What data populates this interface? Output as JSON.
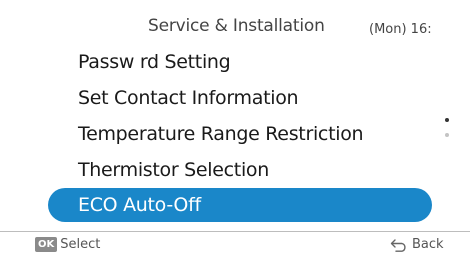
{
  "header": {
    "title": "Service & Installation",
    "clock": "(Mon) 16:"
  },
  "menu": {
    "items": [
      {
        "label": "Passw  rd Setting"
      },
      {
        "label": "Set Contact Information"
      },
      {
        "label": "Temperature Range Restriction"
      },
      {
        "label": "Thermistor Selection"
      },
      {
        "label": "ECO Auto-Off"
      }
    ],
    "selected_index": 4
  },
  "scroll_indicator": {
    "pages": 2,
    "current": 1
  },
  "footer": {
    "ok_badge": "OK",
    "ok_label": "Select",
    "back_label": "Back"
  },
  "colors": {
    "selection": "#1a87c9",
    "text": "#1a1a1a",
    "muted": "#555555"
  }
}
